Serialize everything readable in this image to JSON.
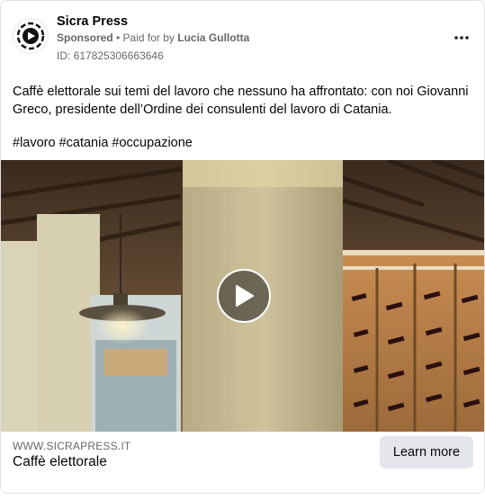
{
  "header": {
    "page_name": "Sicra Press",
    "sponsored_label": "Sponsored",
    "separator": " • ",
    "paid_for_prefix": "Paid for by ",
    "payer_name": "Lucia Gullotta",
    "ad_id": "ID: 617825306663646",
    "more_icon": "more-horizontal-icon"
  },
  "post": {
    "text": "Caffè elettorale sui temi del lavoro che nessuno ha affrontato: con noi Giovanni Greco, presidente dell’Ordine dei consulenti del lavoro di Catania.",
    "hashtags": [
      "#lavoro",
      "#catania",
      "#occupazione"
    ]
  },
  "media": {
    "type": "video",
    "play_icon": "play-icon"
  },
  "link": {
    "domain": "WWW.SICRAPRESS.IT",
    "headline": "Caffè elettorale",
    "cta_label": "Learn more"
  },
  "colors": {
    "secondary_text": "#65676b",
    "button_bg": "#e4e6eb",
    "border": "#dfe1e4"
  }
}
